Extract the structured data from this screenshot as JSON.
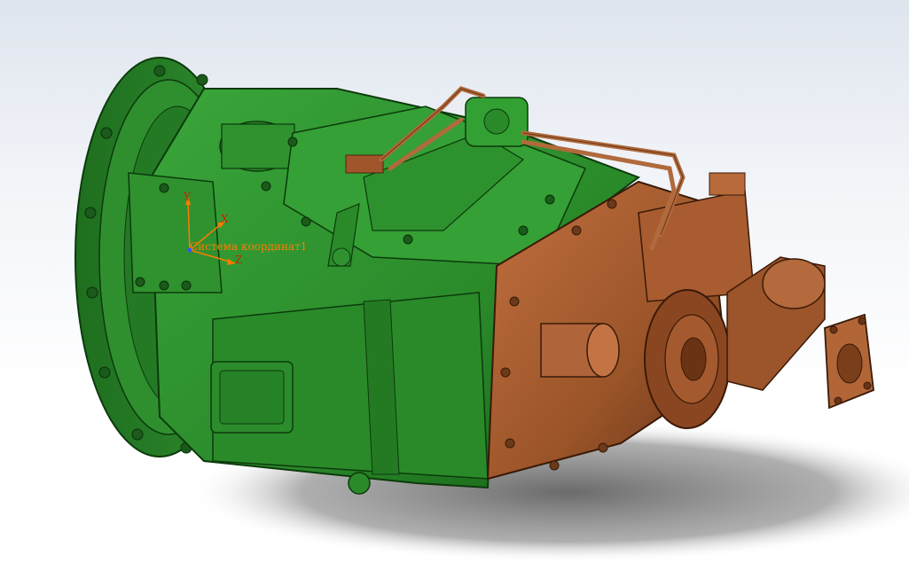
{
  "viewport": {
    "background_top": "#dfe5ee",
    "background_bottom": "#ffffff"
  },
  "model": {
    "gearbox_color": "#2e8b2e",
    "gearbox_shadow": "#145a14",
    "rear_housing_color": "#a0562a",
    "rear_housing_shadow": "#5a2e12",
    "pipe_color": "#b06a3c"
  },
  "coordinate_system": {
    "name": "Система координат1",
    "axis_x": "X",
    "axis_y": "Y",
    "axis_z": "Z",
    "color": "#ff7a00"
  }
}
